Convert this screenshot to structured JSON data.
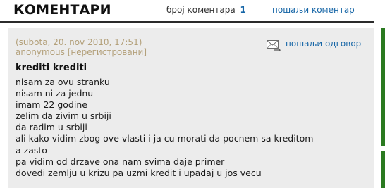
{
  "header": {
    "title": "КОМЕНТАРИ",
    "count_label": "број коментара",
    "count_value": "1",
    "send_comment_link": "пошаљи коментар"
  },
  "comment": {
    "date": "(subota, 20. nov 2010, 17:51)",
    "author": "anonymous [нерегистровани]",
    "reply_label": "пошаљи одговор",
    "reply_icon": "envelope-reply-icon",
    "title": "krediti krediti",
    "body_lines": [
      "nisam za ovu stranku",
      "nisam ni za jednu",
      "imam 22 godine",
      "zelim da zivim u srbiji",
      "da radim u srbiji",
      "ali kako vidim zbog ove vlasti i ja cu morati da pocnem sa kreditom",
      "a zasto",
      "pa vidim od drzave ona nam svima daje primer",
      "dovedi zemlju u krizu pa uzmi kredit i upadaj u jos vecu"
    ]
  },
  "colors": {
    "link": "#1565a6",
    "meta": "#b3a07a",
    "panel": "#ececec",
    "rule": "#2b2b2b",
    "stripe": "#2a7a20"
  }
}
